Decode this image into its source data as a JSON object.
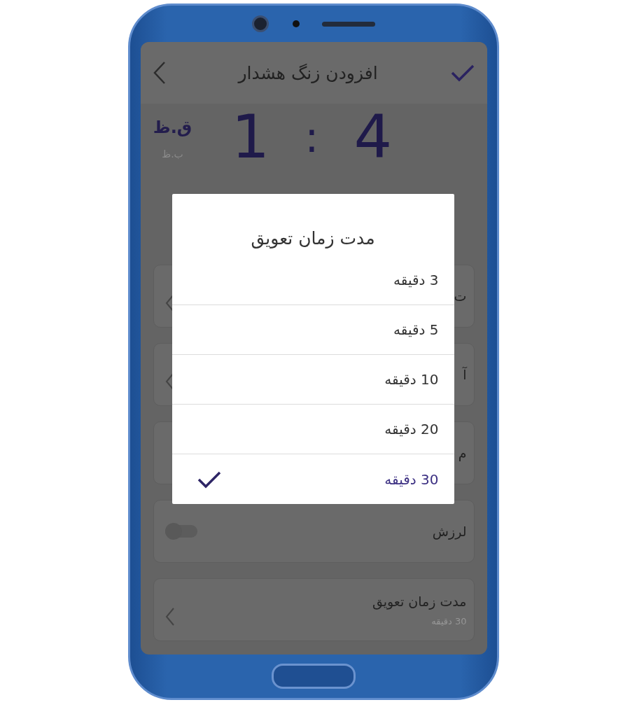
{
  "header": {
    "title": "افزودن زنگ هشدار"
  },
  "time": {
    "am_pm": "ق.ظ",
    "am_pm_alt": "ب.ظ",
    "hour": "1",
    "separator": ":",
    "minute": "4"
  },
  "settings": [
    {
      "kind": "nav",
      "title": "ت"
    },
    {
      "kind": "nav",
      "title": "آ"
    },
    {
      "kind": "plain",
      "title": "م"
    },
    {
      "kind": "toggle",
      "title": "لرزش",
      "on": false
    },
    {
      "kind": "nav",
      "title": "مدت زمان تعویق",
      "value": "30 دقیقه"
    }
  ],
  "dialog": {
    "title": "مدت زمان تعویق",
    "options": [
      {
        "label": "3 دقیقه",
        "selected": false
      },
      {
        "label": "5 دقیقه",
        "selected": false
      },
      {
        "label": "10 دقیقه",
        "selected": false
      },
      {
        "label": "20 دقیقه",
        "selected": false
      },
      {
        "label": "30 دقیقه",
        "selected": true
      }
    ]
  }
}
